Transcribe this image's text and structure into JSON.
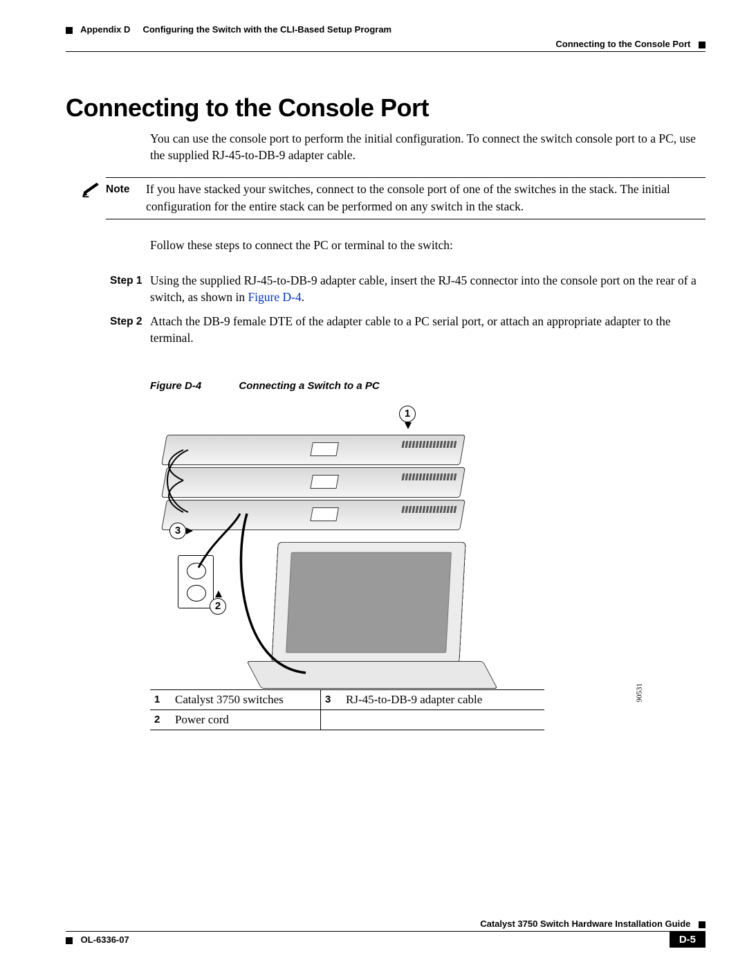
{
  "header": {
    "appendix": "Appendix D",
    "chapter": "Configuring the Switch with the CLI-Based Setup Program",
    "section_right": "Connecting to the Console Port"
  },
  "title": "Connecting to the Console Port",
  "intro": "You can use the console port to perform the initial configuration. To connect the switch console port to a PC, use the supplied RJ-45-to-DB-9 adapter cable.",
  "note": {
    "label": "Note",
    "text": "If you have stacked your switches, connect to the console port of one of the switches in the stack. The initial configuration for the entire stack can be performed on any switch in the stack."
  },
  "follow": "Follow these steps to connect the PC or terminal to the switch:",
  "steps": [
    {
      "label": "Step 1",
      "text_a": "Using the supplied RJ-45-to-DB-9 adapter cable, insert the RJ-45 connector into the console port on the rear of a switch, as shown in ",
      "figref": "Figure D-4",
      "text_b": "."
    },
    {
      "label": "Step 2",
      "text_a": "Attach the DB-9 female DTE of the adapter cable to a PC serial port, or attach an appropriate adapter to the terminal.",
      "figref": "",
      "text_b": ""
    }
  ],
  "figure": {
    "number": "Figure D-4",
    "caption": "Connecting a Switch to a PC",
    "callouts": {
      "c1": "1",
      "c2": "2",
      "c3": "3"
    },
    "image_id": "90531"
  },
  "legend": {
    "r1n": "1",
    "r1t": "Catalyst 3750 switches",
    "r1n2": "3",
    "r1t2": "RJ-45-to-DB-9 adapter cable",
    "r2n": "2",
    "r2t": "Power cord"
  },
  "footer": {
    "guide": "Catalyst 3750 Switch Hardware Installation Guide",
    "doc": "OL-6336-07",
    "page": "D-5"
  }
}
